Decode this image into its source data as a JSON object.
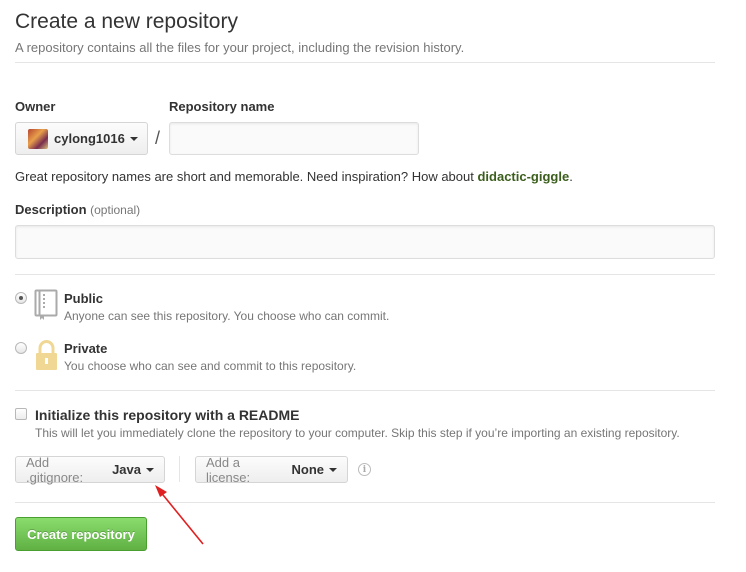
{
  "header": {
    "title": "Create a new repository",
    "subtitle": "A repository contains all the files for your project, including the revision history."
  },
  "owner": {
    "label": "Owner",
    "username": "cylong1016"
  },
  "repo_name": {
    "label": "Repository name",
    "value": "",
    "separator": "/"
  },
  "hint": {
    "prefix": "Great repository names are short and memorable. Need inspiration? How about ",
    "suggestion": "didactic-giggle",
    "suffix": "."
  },
  "description": {
    "label": "Description",
    "optional": "(optional)",
    "value": ""
  },
  "visibility": {
    "selected": "public",
    "public": {
      "title": "Public",
      "desc": "Anyone can see this repository. You choose who can commit."
    },
    "private": {
      "title": "Private",
      "desc": "You choose who can see and commit to this repository."
    }
  },
  "readme": {
    "checked": false,
    "title": "Initialize this repository with a README",
    "desc": "This will let you immediately clone the repository to your computer. Skip this step if you’re importing an existing repository."
  },
  "gitignore": {
    "label": "Add .gitignore:",
    "value": "Java"
  },
  "license": {
    "label": "Add a license:",
    "value": "None"
  },
  "submit": {
    "label": "Create repository"
  },
  "colors": {
    "primary_green": "#60b044",
    "suggestion_green": "#3b5e1c",
    "annotation_red": "#e02020",
    "book_icon": "#aaaaaa",
    "lock_icon": "#f0d894"
  }
}
